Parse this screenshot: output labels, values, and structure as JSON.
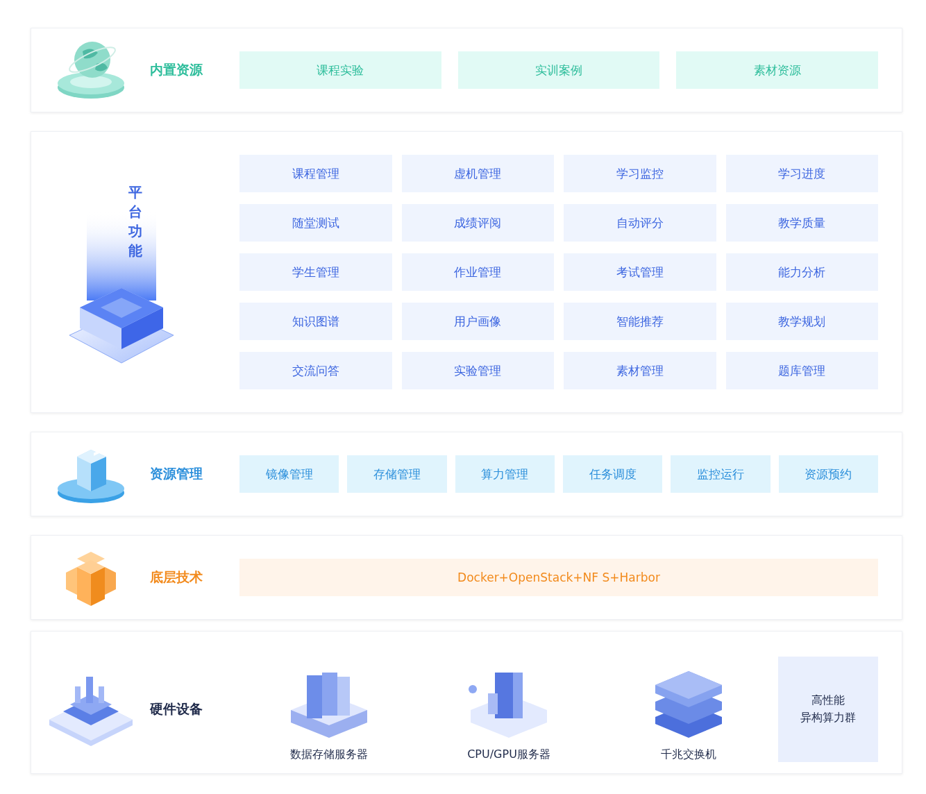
{
  "sections": [
    {
      "kind": "resources",
      "title": "内置资源",
      "items": [
        "课程实验",
        "实训案例",
        "素材资源"
      ]
    },
    {
      "kind": "platform",
      "title": "平台功能",
      "items": [
        "课程管理",
        "虚机管理",
        "学习监控",
        "学习进度",
        "随堂测试",
        "成绩评阅",
        "自动评分",
        "教学质量",
        "学生管理",
        "作业管理",
        "考试管理",
        "能力分析",
        "知识图谱",
        "用户画像",
        "智能推荐",
        "教学规划",
        "交流问答",
        "实验管理",
        "素材管理",
        "题库管理"
      ]
    },
    {
      "kind": "management",
      "title": "资源管理",
      "items": [
        "镜像管理",
        "存储管理",
        "算力管理",
        "任务调度",
        "监控运行",
        "资源预约"
      ]
    },
    {
      "kind": "tech",
      "title": "底层技术",
      "text": "Docker+OpenStack+NF S+Harbor"
    },
    {
      "kind": "hardware",
      "title": "硬件设备",
      "devices": [
        {
          "kind": "storage",
          "label": "数据存储服务器"
        },
        {
          "kind": "server",
          "label": "CPU/GPU服务器"
        },
        {
          "kind": "switch",
          "label": "千兆交换机"
        },
        {
          "kind": "cluster",
          "lines": [
            "高性能",
            "异构算力群"
          ]
        }
      ]
    }
  ]
}
